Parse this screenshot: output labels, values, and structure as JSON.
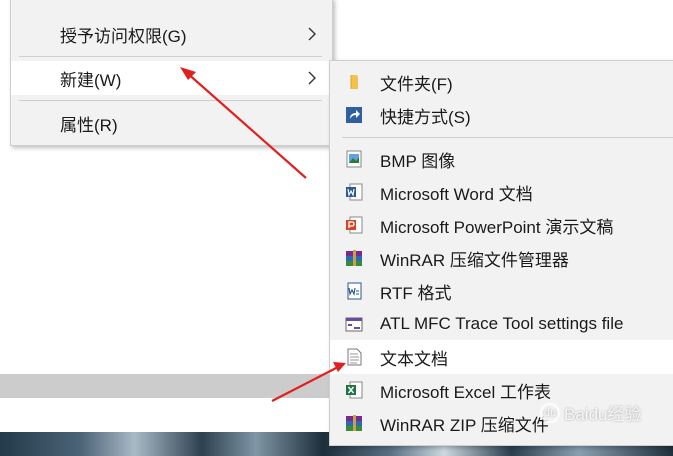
{
  "context_menu": {
    "items": [
      {
        "label": "授予访问权限(G)",
        "icon": "chevron-right-icon"
      },
      {
        "label": "新建(W)",
        "icon": "chevron-right-icon"
      },
      {
        "label": "属性(R)"
      }
    ]
  },
  "new_submenu": {
    "items": [
      {
        "label": "文件夹(F)",
        "icon": "folder-icon"
      },
      {
        "label": "快捷方式(S)",
        "icon": "shortcut-icon"
      },
      {
        "label": "BMP 图像",
        "icon": "bmp-image-icon"
      },
      {
        "label": "Microsoft Word 文档",
        "icon": "word-icon"
      },
      {
        "label": "Microsoft PowerPoint 演示文稿",
        "icon": "powerpoint-icon"
      },
      {
        "label": "WinRAR 压缩文件管理器",
        "icon": "winrar-icon"
      },
      {
        "label": "RTF 格式",
        "icon": "rtf-icon"
      },
      {
        "label": "ATL MFC Trace Tool settings file",
        "icon": "trace-tool-icon"
      },
      {
        "label": "文本文档",
        "icon": "text-document-icon"
      },
      {
        "label": "Microsoft Excel 工作表",
        "icon": "excel-icon"
      },
      {
        "label": "WinRAR ZIP 压缩文件",
        "icon": "winrar-zip-icon"
      }
    ]
  },
  "watermark": {
    "text": "Baidu经验",
    "logo_text": "du"
  },
  "colors": {
    "menu_background": "#f2f2f2",
    "highlight": "#ffffff",
    "annotation_arrow": "#e02020"
  }
}
